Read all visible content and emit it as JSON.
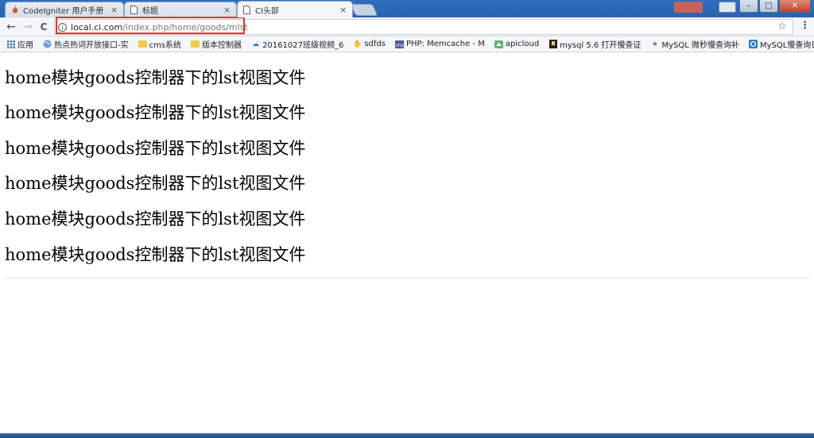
{
  "tabs": [
    {
      "title": "CodeIgniter 用户手册 ·",
      "icon": "codeigniter-flame-icon"
    },
    {
      "title": "标题",
      "icon": "page-icon"
    },
    {
      "title": "CI头部",
      "icon": "page-icon",
      "active": true
    }
  ],
  "window": {
    "minimize": "–",
    "maximize": "□",
    "close": "✕"
  },
  "toolbar": {
    "back": "←",
    "forward": "→",
    "reload": "C",
    "url_host": "local.ci.com",
    "url_path": "/index.php/home/goods/mlst",
    "star": "☆",
    "menu": "⋮"
  },
  "bookmarks": [
    {
      "label": "应用",
      "icon": "apps-grid-icon"
    },
    {
      "label": "热点热词开放接口-实",
      "icon": "globe-icon"
    },
    {
      "label": "cms系统",
      "icon": "folder-icon"
    },
    {
      "label": "版本控制器",
      "icon": "folder-icon"
    },
    {
      "label": "20161027班级视频_6",
      "icon": "cloud-icon"
    },
    {
      "label": "sdfds",
      "icon": "thumb-icon"
    },
    {
      "label": "PHP: Memcache - M",
      "icon": "php-icon"
    },
    {
      "label": "apicloud",
      "icon": "apicloud-icon"
    },
    {
      "label": "mysql 5.6 打开慢查证",
      "icon": "bookmark-icon"
    },
    {
      "label": "MySQL 微秒慢查询补",
      "icon": "star-icon"
    },
    {
      "label": "MySQL慢查询日志总",
      "icon": "blog-icon"
    }
  ],
  "bookmarks_more": "»",
  "content": {
    "lines": [
      "home模块goods控制器下的lst视图文件",
      "home模块goods控制器下的lst视图文件",
      "home模块goods控制器下的lst视图文件",
      "home模块goods控制器下的lst视图文件",
      "home模块goods控制器下的lst视图文件",
      "home模块goods控制器下的lst视图文件"
    ]
  }
}
